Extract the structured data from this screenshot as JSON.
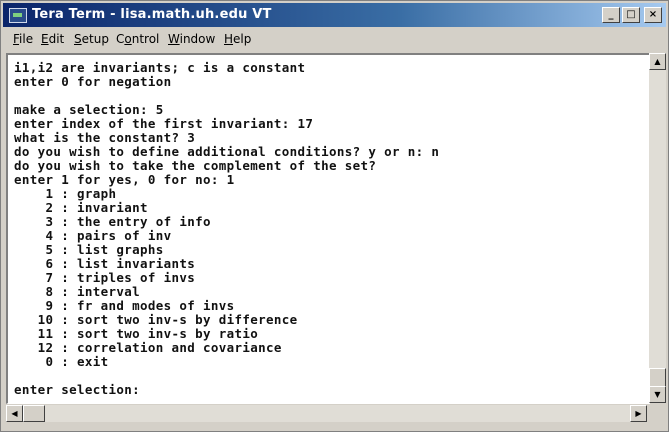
{
  "window": {
    "title": "Tera Term - lisa.math.uh.edu VT"
  },
  "title_buttons": {
    "minimize": "_",
    "maximize": "□",
    "close": "×"
  },
  "menu": {
    "file": {
      "u": "F",
      "rest": "ile"
    },
    "edit": {
      "u": "E",
      "rest": "dit"
    },
    "setup": {
      "u": "S",
      "rest": "etup"
    },
    "control": {
      "pre": "C",
      "u": "o",
      "rest": "ntrol"
    },
    "window": {
      "u": "W",
      "rest": "indow"
    },
    "help": {
      "u": "H",
      "rest": "elp"
    }
  },
  "terminal": {
    "lines": [
      "i1,i2 are invariants; c is a constant",
      "enter 0 for negation",
      "",
      "make a selection: 5",
      "enter index of the first invariant: 17",
      "what is the constant? 3",
      "do you wish to define additional conditions? y or n: n",
      "do you wish to take the complement of the set?",
      "enter 1 for yes, 0 for no: 1",
      "    1 : graph",
      "    2 : invariant",
      "    3 : the entry of info",
      "    4 : pairs of inv",
      "    5 : list graphs",
      "    6 : list invariants",
      "    7 : triples of invs",
      "    8 : interval",
      "    9 : fr and modes of invs",
      "   10 : sort two inv-s by difference",
      "   11 : sort two inv-s by ratio",
      "   12 : correlation and covariance",
      "    0 : exit",
      "",
      "enter selection:"
    ]
  },
  "scrollbars": {
    "up": "▲",
    "down": "▼",
    "left": "◀",
    "right": "▶"
  }
}
